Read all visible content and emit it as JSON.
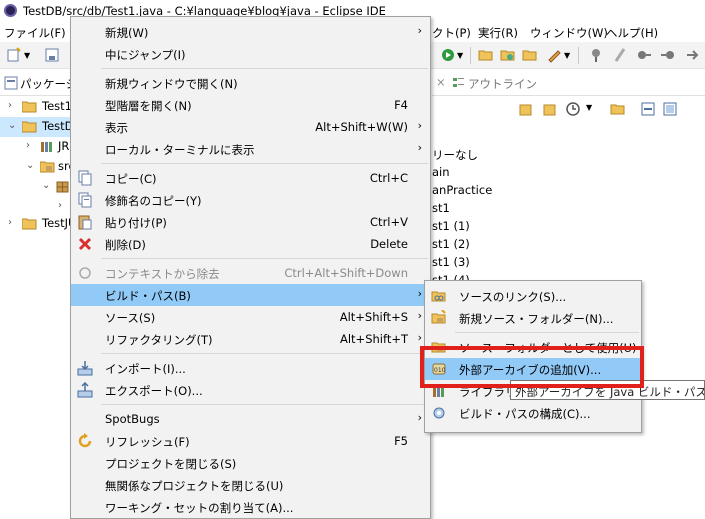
{
  "window": {
    "title": "TestDB/src/db/Test1.java - C:¥language¥blog¥java - Eclipse IDE"
  },
  "menubar": {
    "items": [
      "ファイル(F)",
      "クト(P)",
      "実行(R)",
      "ウィンドウ(W)",
      "ヘルプ(H)"
    ]
  },
  "explorer": {
    "tab_label": "パッケージ",
    "tree": [
      {
        "label": "Test1",
        "expanded": false
      },
      {
        "label": "TestD",
        "expanded": true
      },
      {
        "label": "JR",
        "expanded": false
      },
      {
        "label": "src",
        "expanded": true
      },
      {
        "label": "",
        "expanded": true
      },
      {
        "label": "",
        "expanded": false
      },
      {
        "label": "TestJU",
        "expanded": false
      }
    ]
  },
  "outline": {
    "tab_label": "アウトライン",
    "items": [
      "リーなし",
      "ain",
      "anPractice",
      "st1",
      "st1 (1)",
      "st1 (2)",
      "st1 (3)",
      "st1 (4)"
    ]
  },
  "context_menu": {
    "items": [
      {
        "label": "新規(W)",
        "accel": "",
        "submenu": true,
        "icon": ""
      },
      {
        "label": "中にジャンプ(I)",
        "accel": "",
        "submenu": false,
        "icon": ""
      },
      {
        "sep": true
      },
      {
        "label": "新規ウィンドウで開く(N)",
        "accel": "",
        "submenu": false,
        "icon": ""
      },
      {
        "label": "型階層を開く(N)",
        "accel": "F4",
        "submenu": false,
        "icon": ""
      },
      {
        "label": "表示",
        "accel": "Alt+Shift+W(W)",
        "submenu": true,
        "icon": ""
      },
      {
        "label": "ローカル・ターミナルに表示",
        "accel": "",
        "submenu": true,
        "icon": ""
      },
      {
        "sep": true
      },
      {
        "label": "コピー(C)",
        "accel": "Ctrl+C",
        "submenu": false,
        "icon": "copy-icon"
      },
      {
        "label": "修飾名のコピー(Y)",
        "accel": "",
        "submenu": false,
        "icon": "copy-qualified-name-icon"
      },
      {
        "label": "貼り付け(P)",
        "accel": "Ctrl+V",
        "submenu": false,
        "icon": "paste-icon"
      },
      {
        "label": "削除(D)",
        "accel": "Delete",
        "submenu": false,
        "icon": "delete-icon"
      },
      {
        "sep": true
      },
      {
        "label": "コンテキストから除去",
        "accel": "Ctrl+Alt+Shift+Down",
        "submenu": false,
        "icon": "remove-context-icon",
        "disabled": true
      },
      {
        "label": "ビルド・パス(B)",
        "accel": "",
        "submenu": true,
        "icon": "",
        "highlighted": true
      },
      {
        "label": "ソース(S)",
        "accel": "Alt+Shift+S",
        "submenu": true,
        "icon": ""
      },
      {
        "label": "リファクタリング(T)",
        "accel": "Alt+Shift+T",
        "submenu": true,
        "icon": ""
      },
      {
        "sep": true
      },
      {
        "label": "インポート(I)...",
        "accel": "",
        "submenu": false,
        "icon": "import-icon"
      },
      {
        "label": "エクスポート(O)...",
        "accel": "",
        "submenu": false,
        "icon": "export-icon"
      },
      {
        "sep": true
      },
      {
        "label": "SpotBugs",
        "accel": "",
        "submenu": true,
        "icon": ""
      },
      {
        "label": "リフレッシュ(F)",
        "accel": "F5",
        "submenu": false,
        "icon": "refresh-icon"
      },
      {
        "label": "プロジェクトを閉じる(S)",
        "accel": "",
        "submenu": false,
        "icon": ""
      },
      {
        "label": "無関係なプロジェクトを閉じる(U)",
        "accel": "",
        "submenu": false,
        "icon": ""
      },
      {
        "label": "ワーキング・セットの割り当て(A)...",
        "accel": "",
        "submenu": false,
        "icon": ""
      }
    ]
  },
  "submenu": {
    "items": [
      {
        "label": "ソースのリンク(S)...",
        "icon": "link-source-icon"
      },
      {
        "label": "新規ソース・フォルダー(N)...",
        "icon": "new-source-folder-icon"
      },
      {
        "sep": true
      },
      {
        "label": "ソース・フォルダーとして使用(U)",
        "icon": "use-as-source-folder-icon"
      },
      {
        "label": "外部アーカイブの追加(V)...",
        "icon": "add-external-archive-icon",
        "highlighted": true
      },
      {
        "label": "ライブラリーの追加(L)...",
        "icon": "add-library-icon"
      },
      {
        "label": "ビルド・パスの構成(C)...",
        "icon": "configure-build-path-icon"
      }
    ]
  },
  "tooltip": {
    "text": "外部アーカイブを Java ビルド・パスに追加"
  },
  "colors": {
    "highlight": "#91c9f7",
    "annotation_red": "#e0201b",
    "selection": "#cce8ff"
  }
}
